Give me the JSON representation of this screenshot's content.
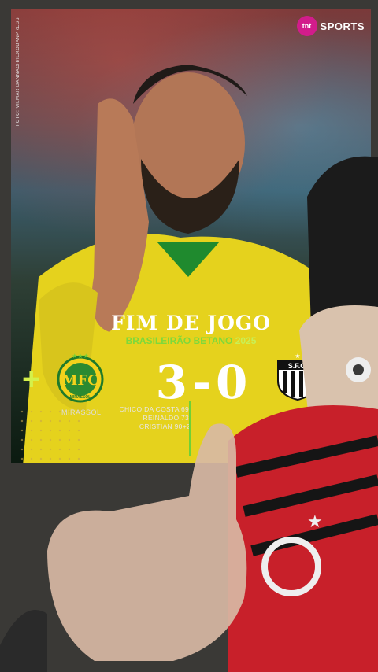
{
  "card": {
    "photo_credit": "FOTO: VILMAR BANNACH/IEXOBANPRESS",
    "network": {
      "logo_text": "tnt",
      "label": "SPORTS",
      "brand_color": "#d21c8b"
    },
    "headline": "FIM DE JOGO",
    "competition": {
      "name": "BRASILEIRÃO BETANO",
      "year": "2025"
    },
    "home_team": {
      "name": "MIRASSOL",
      "badge_text": "MFC",
      "badge_sub": "MIRASSOL",
      "color": "#f2d21c"
    },
    "away_team": {
      "badge_text": "S.F.C."
    },
    "score": "3-0",
    "scorers": [
      "CHICO DA COSTA 69'",
      "REINALDO 73'",
      "CRISTIAN 90+2"
    ],
    "accent": "#6fd137"
  }
}
